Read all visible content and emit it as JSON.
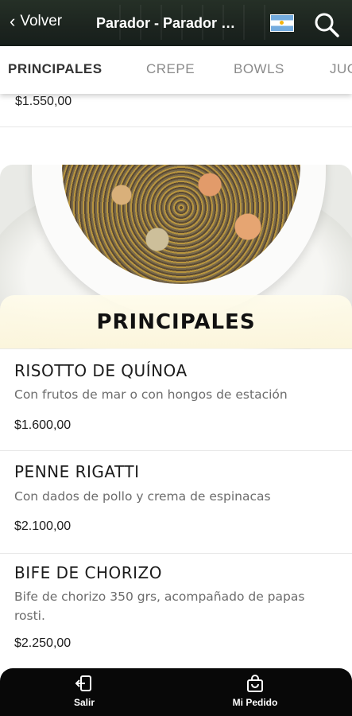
{
  "header": {
    "back_label": "Volver",
    "title": "Parador - Parador Bar",
    "flag": "argentina-flag-icon"
  },
  "tabs": [
    {
      "label": "PRINCIPALES",
      "active": true
    },
    {
      "label": "CREPE",
      "active": false
    },
    {
      "label": "BOWLS",
      "active": false
    },
    {
      "label": "JUGOS",
      "active": false
    }
  ],
  "previous_item": {
    "price": "$1.550,00"
  },
  "section": {
    "title": "PRINCIPALES"
  },
  "items": [
    {
      "name": "RISOTTO DE QUÍNOA",
      "description": "Con frutos de mar o con hongos de estación",
      "price": "$1.600,00"
    },
    {
      "name": "PENNE RIGATTI",
      "description": "Con dados de pollo y crema de espinacas",
      "price": "$2.100,00"
    },
    {
      "name": "BIFE DE CHORIZO",
      "description": "Bife de chorizo 350 grs, acompañado de papas rosti.",
      "price": "$2.250,00"
    }
  ],
  "bottom_nav": {
    "exit_label": "Salir",
    "order_label": "Mi Pedido"
  },
  "colors": {
    "bottom_bar": "#080808",
    "section_header_bg": "#fbf5dc",
    "active_tab": "#333333",
    "inactive_tab": "#8a8a8a"
  }
}
